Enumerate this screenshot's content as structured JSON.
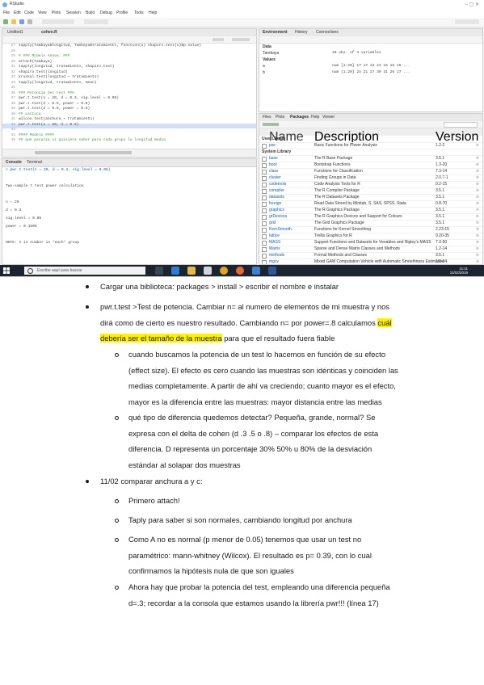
{
  "screenshot": {
    "app_title": "RStudio",
    "menu": [
      "File",
      "Edit",
      "Code",
      "View",
      "Plots",
      "Session",
      "Build",
      "Debug",
      "Profile",
      "Tools",
      "Help"
    ],
    "source_tabs": [
      "Untitled1",
      "cohen.R"
    ],
    "code_lines": [
      {
        "n": "27",
        "t": "tapply(Tambaya$longitud, Tambaya$tratamiento, function(x) shapiro.test(x)$p.value)"
      },
      {
        "n": "28",
        "t": ""
      },
      {
        "n": "29",
        "t": "# ### Modelo Anova: ###"
      },
      {
        "n": "30",
        "t": "attach(Tambaya)"
      },
      {
        "n": "31",
        "t": "tapply(longitud, tratamiento, shapiro.test)"
      },
      {
        "n": "32",
        "t": "shapiro.test(longitud)"
      },
      {
        "n": "33",
        "t": "kruskal.test(longitud ~ tratamiento)"
      },
      {
        "n": "34",
        "t": "tapply(longitud, tratamiento, mean)"
      },
      {
        "n": "35",
        "t": ""
      },
      {
        "n": "36",
        "t": "### Potencia del test ###"
      },
      {
        "n": "37",
        "t": "pwr.t.test(n = 20, d = 0.3, sig.level = 0.05)"
      },
      {
        "n": "38",
        "t": "pwr.t.test(d = 0.5, power = 0.8)"
      },
      {
        "n": "39",
        "t": "pwr.t.test(d = 0.8, power = 0.8)"
      },
      {
        "n": "40",
        "t": "## Lactuca"
      },
      {
        "n": "41",
        "t": "wilcox.test(anchura ~ tratamiento)"
      },
      {
        "n": "42",
        "t": "pwr.t.test(n = 20, d = 0.3)"
      },
      {
        "n": "43",
        "t": ""
      },
      {
        "n": "44",
        "t": "#### Modelo ####"
      },
      {
        "n": "45",
        "t": "## que pasaria si quisiera saber para cada grupo la longitud media"
      }
    ],
    "console_tabs": [
      "Console",
      "Terminal"
    ],
    "console_lines": [
      "> pwr.t.test(n = 20, d = 0.3, sig.level = 0.05)",
      "",
      "     Two-sample t test power calculation",
      "",
      "              n = 20",
      "              d = 0.3",
      "      sig.level = 0.05",
      "          power = 0.1506",
      "",
      "NOTE: n is number in *each* group"
    ],
    "env_tabs": [
      "Environment",
      "History",
      "Connections"
    ],
    "env_rows": [
      {
        "k": "Data",
        "v": ""
      },
      {
        "k": "Tambaya",
        "v": "40 obs. of 3 variables"
      },
      {
        "k": "Values",
        "v": ""
      },
      {
        "k": "a",
        "v": "num [1:20] 17 17 13 23 16 18 15 ..."
      },
      {
        "k": "b",
        "v": "num [1:20] 24 21 27 30 31 26 27 ..."
      }
    ],
    "files_tabs": [
      "Files",
      "Plots",
      "Packages",
      "Help",
      "Viewer"
    ],
    "pkg_header": [
      "Name",
      "Description",
      "Version"
    ],
    "packages": [
      {
        "name": "User Library",
        "desc": "",
        "ver": ""
      },
      {
        "name": "pwr",
        "desc": "Basic Functions for Power Analysis",
        "ver": "1.2-2"
      },
      {
        "name": "System Library",
        "desc": "",
        "ver": ""
      },
      {
        "name": "base",
        "desc": "The R Base Package",
        "ver": "3.5.1"
      },
      {
        "name": "boot",
        "desc": "Bootstrap Functions",
        "ver": "1.3-20"
      },
      {
        "name": "class",
        "desc": "Functions for Classification",
        "ver": "7.3-14"
      },
      {
        "name": "cluster",
        "desc": "Finding Groups in Data",
        "ver": "2.0.7-1"
      },
      {
        "name": "codetools",
        "desc": "Code Analysis Tools for R",
        "ver": "0.2-15"
      },
      {
        "name": "compiler",
        "desc": "The R Compiler Package",
        "ver": "3.5.1"
      },
      {
        "name": "datasets",
        "desc": "The R Datasets Package",
        "ver": "3.5.1"
      },
      {
        "name": "foreign",
        "desc": "Read Data Stored by Minitab, S, SAS, SPSS, Stata",
        "ver": "0.8-70"
      },
      {
        "name": "graphics",
        "desc": "The R Graphics Package",
        "ver": "3.5.1"
      },
      {
        "name": "grDevices",
        "desc": "The R Graphics Devices and Support for Colours",
        "ver": "3.5.1"
      },
      {
        "name": "grid",
        "desc": "The Grid Graphics Package",
        "ver": "3.5.1"
      },
      {
        "name": "KernSmooth",
        "desc": "Functions for Kernel Smoothing",
        "ver": "2.23-15"
      },
      {
        "name": "lattice",
        "desc": "Trellis Graphics for R",
        "ver": "0.20-35"
      },
      {
        "name": "MASS",
        "desc": "Support Functions and Datasets for Venables and Ripley's MASS",
        "ver": "7.3-50"
      },
      {
        "name": "Matrix",
        "desc": "Sparse and Dense Matrix Classes and Methods",
        "ver": "1.2-14"
      },
      {
        "name": "methods",
        "desc": "Formal Methods and Classes",
        "ver": "3.5.1"
      },
      {
        "name": "mgcv",
        "desc": "Mixed GAM Computation Vehicle with Automatic Smoothness Estimation",
        "ver": "1.8-24"
      }
    ],
    "taskbar_search": "Escribe aquí para buscar",
    "clock_time": "11:11",
    "clock_date": "11/02/2019"
  },
  "notes": {
    "b1": "Cargar una biblioteca: packages > install > escribir el nombre e instalar",
    "b2_a": "pwr.t.test >Test de potencia. Cambiar n= al numero de elementos de mi muestra y nos",
    "b2_b": "dirá como de cierto es nuestro resultado. Cambiando n= por power=.8 calculamos ",
    "b2_hl1": "cuál",
    "b2_hl2": "debería ser el tamaño de la muestra",
    "b2_c": " para que el resultado fuera fiable",
    "s1_l1": "cuando buscamos la potencia de un test lo hacemos en función de su efecto",
    "s1_l2": "(effect size).  El efecto es cero cuando las muestras son idénticas y coinciden las",
    "s1_l3": "medias completamente. A partir de ahí va creciendo; cuanto mayor es el efecto,",
    "s1_l4": "mayor es la diferencia entre las muestras: mayor distancia entre las medias",
    "s2_l1": "qué tipo de diferencia quedemos detectar? Pequeña, grande, normal? Se",
    "s2_l2": "expresa con el delta de cohen (d .3 .5 o .8) – comparar los efectos de esta",
    "s2_l3": "diferencia. D representa un porcentaje 30% 50% u 80% de la desviación",
    "s2_l4": "estándar al solapar dos muestras",
    "b3": "11/02 comparar anchura a y c:",
    "c1": "Primero attach!",
    "c2": "Taply para saber si son normales, cambiando longitud por anchura",
    "c3_l1": "Como A no es normal (p menor de 0.05) tenemos que usar un test no",
    "c3_l2": "paramétrico: mann-whitney (Wilcox). El resultado es p= 0.39, con lo cual",
    "c3_l3": "confirmamos la hipótesis nula de que son iguales",
    "c4_l1": "Ahora hay que probar la potencia del test, empleando una diferencia pequeña",
    "c4_l2": "d=.3; recordar a la consola que estamos usando la librería pwr!!! (línea 17)"
  }
}
